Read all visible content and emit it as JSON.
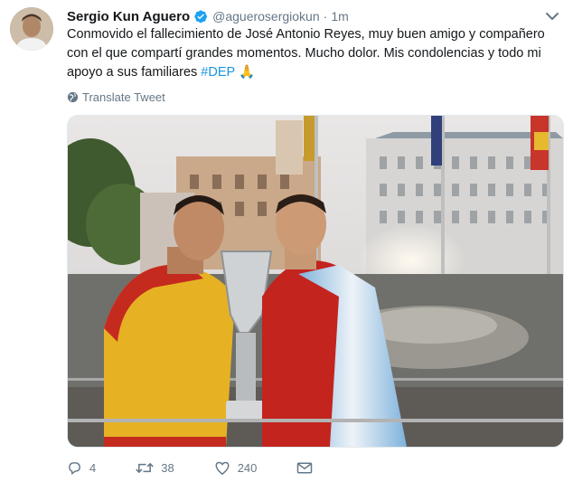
{
  "author": {
    "display_name": "Sergio Kun Aguero",
    "handle": "@aguerosergiokun",
    "separator": "·",
    "time": "1m"
  },
  "tweet": {
    "text_main": "Conmovido el fallecimiento de José Antonio Reyes, muy buen amigo y compañero con el que compartí grandes momentos. Mucho dolor. Mis condolencias y todo mi apoyo a sus familiares ",
    "hashtag": "#DEP",
    "emoji": "🙏"
  },
  "translate_label": "Translate Tweet",
  "actions": {
    "reply_count": "4",
    "retweet_count": "38",
    "like_count": "240"
  },
  "colors": {
    "link_blue": "#1b95e0",
    "muted_gray": "#657786",
    "text": "#14171a"
  },
  "icons": [
    "verified-badge-icon",
    "chevron-down-icon",
    "globe-icon",
    "reply-icon",
    "retweet-icon",
    "like-icon",
    "message-icon"
  ]
}
